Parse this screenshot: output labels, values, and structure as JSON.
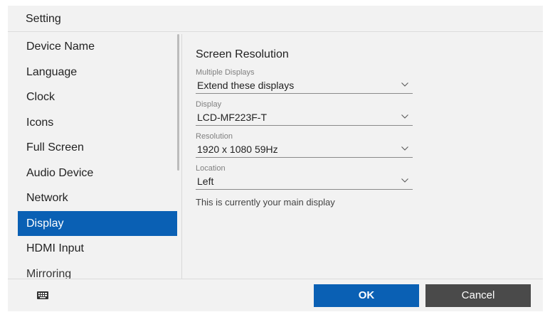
{
  "window": {
    "title": "Setting"
  },
  "sidebar": {
    "items": [
      {
        "label": "Device Name"
      },
      {
        "label": "Language"
      },
      {
        "label": "Clock"
      },
      {
        "label": "Icons"
      },
      {
        "label": "Full Screen"
      },
      {
        "label": "Audio Device"
      },
      {
        "label": "Network"
      },
      {
        "label": "Display"
      },
      {
        "label": "HDMI Input"
      },
      {
        "label": "Mirroring"
      }
    ],
    "selected": "Display"
  },
  "content": {
    "section_title": "Screen Resolution",
    "fields": [
      {
        "label": "Multiple Displays",
        "value": "Extend these displays"
      },
      {
        "label": "Display",
        "value": "LCD-MF223F-T"
      },
      {
        "label": "Resolution",
        "value": "1920 x 1080 59Hz"
      },
      {
        "label": "Location",
        "value": "Left"
      }
    ],
    "note": "This is currently your main display"
  },
  "footer": {
    "keyboard_icon": "keyboard-icon",
    "ok_label": "OK",
    "cancel_label": "Cancel"
  },
  "colors": {
    "accent": "#0a60b4",
    "dialog_bg": "#f2f2f2",
    "cancel_bg": "#4a4a4a"
  }
}
